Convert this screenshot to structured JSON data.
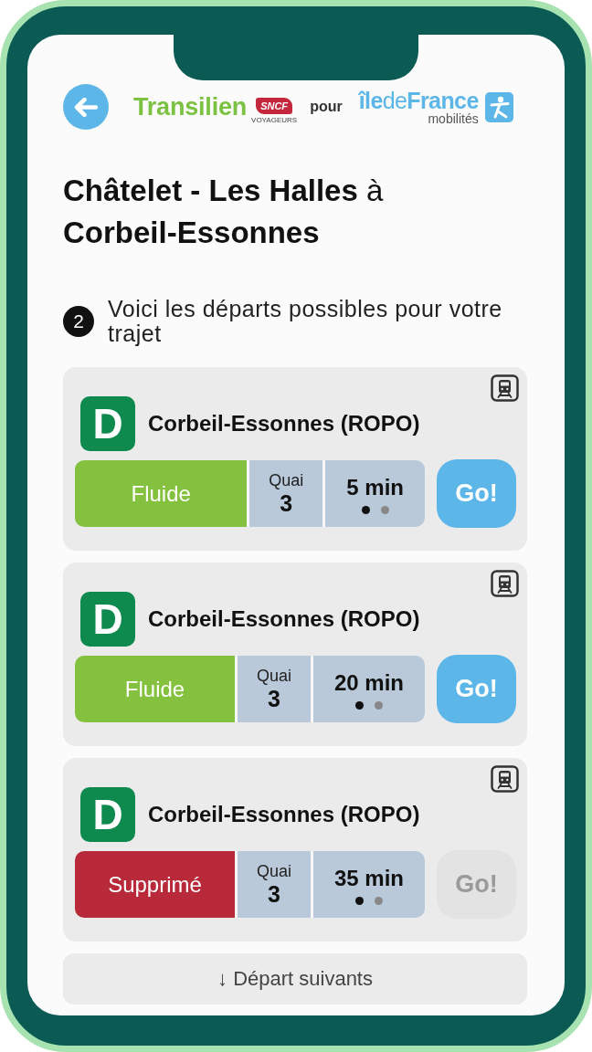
{
  "logos": {
    "transilien": "Transilien",
    "sncf": "SNCF",
    "sncf_tagline": "VOYAGEURS",
    "connector": "pour",
    "idf": "**île**de**France**",
    "idf_tagline": "mobilités"
  },
  "title": "**Châtelet - Les Halles** à **Corbeil-Essonnes**",
  "step": {
    "number": "2",
    "text": "Voici les départs possibles pour votre trajet"
  },
  "departures": [
    {
      "line": "D",
      "destination": "Corbeil-Essonnes (ROPO)",
      "status": {
        "kind": "normal",
        "label": "Fluide"
      },
      "quai_label": "Quai",
      "quai": "3",
      "time": "5 min",
      "pager": [
        {
          "selected": true
        },
        {
          "selected": false
        }
      ],
      "go": {
        "label": "Go!",
        "disabled": false
      }
    },
    {
      "line": "D",
      "destination": "Corbeil-Essonnes (ROPO)",
      "status": {
        "kind": "normal",
        "label": "Fluide"
      },
      "quai_label": "Quai",
      "quai": "3",
      "time": "20 min",
      "pager": [
        {
          "selected": true
        },
        {
          "selected": false
        }
      ],
      "go": {
        "label": "Go!",
        "disabled": false
      }
    },
    {
      "line": "D",
      "destination": "Corbeil-Essonnes (ROPO)",
      "status": {
        "kind": "cancelled",
        "label": "Supprimé"
      },
      "quai_label": "Quai",
      "quai": "3",
      "time": "35 min",
      "pager": [
        {
          "selected": true
        },
        {
          "selected": false
        }
      ],
      "go": {
        "label": "Go!",
        "disabled": true
      }
    }
  ],
  "more_button": "↓ Départ suivants"
}
